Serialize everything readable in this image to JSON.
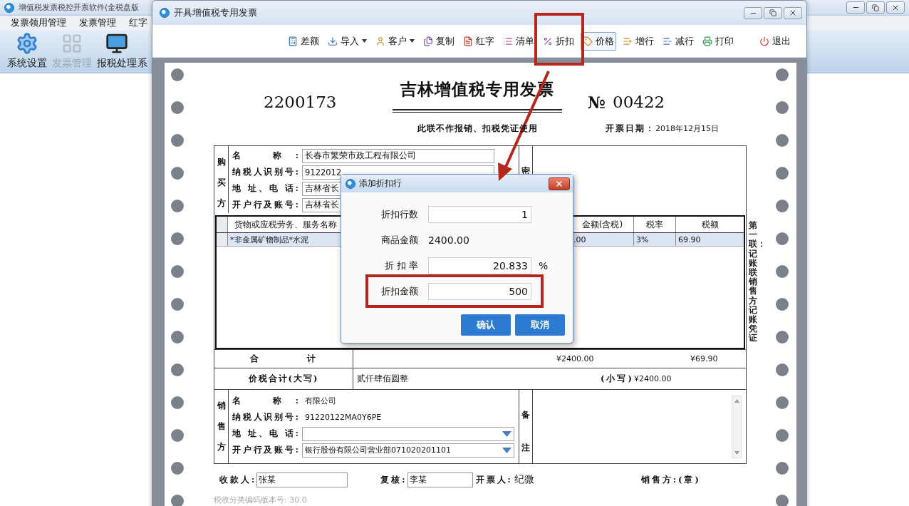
{
  "main_window": {
    "title": "增值税发票税控开票软件(金税盘版",
    "menu": [
      "发票领用管理",
      "发票管理",
      "红字"
    ],
    "toolbar": [
      {
        "label": "系统设置",
        "kind": "gear",
        "disabled": false
      },
      {
        "label": "发票管理",
        "kind": "grid",
        "disabled": true
      },
      {
        "label": "报税处理",
        "kind": "monitor",
        "disabled": false
      },
      {
        "label": "系",
        "kind": "none",
        "disabled": false
      }
    ]
  },
  "invoice_window": {
    "title": "开具增值税专用发票",
    "toolbar": [
      {
        "label": "差额",
        "kind": "calculator",
        "dropdown": false,
        "selected": false,
        "highlighted": false
      },
      {
        "label": "导入",
        "kind": "import",
        "dropdown": true,
        "selected": false,
        "highlighted": false
      },
      {
        "label": "客户",
        "kind": "customer",
        "dropdown": true,
        "selected": false,
        "highlighted": false
      },
      {
        "label": "复制",
        "kind": "copy",
        "dropdown": false,
        "selected": false,
        "highlighted": false
      },
      {
        "label": "红字",
        "kind": "red",
        "dropdown": false,
        "selected": false,
        "highlighted": false
      },
      {
        "label": "清单",
        "kind": "list",
        "dropdown": false,
        "selected": false,
        "highlighted": false
      },
      {
        "label": "折扣",
        "kind": "discount",
        "dropdown": false,
        "selected": false,
        "highlighted": true
      },
      {
        "label": "价格",
        "kind": "price",
        "dropdown": false,
        "selected": true,
        "highlighted": false
      },
      {
        "label": "增行",
        "kind": "add_row",
        "dropdown": false,
        "selected": false,
        "highlighted": false
      },
      {
        "label": "减行",
        "kind": "remove_row",
        "dropdown": false,
        "selected": false,
        "highlighted": false
      },
      {
        "label": "打印",
        "kind": "print",
        "dropdown": false,
        "selected": false,
        "highlighted": false
      },
      {
        "label": "退出",
        "kind": "exit",
        "dropdown": false,
        "selected": false,
        "highlighted": false
      }
    ]
  },
  "invoice": {
    "code": "2200173",
    "title": "吉林增值税专用发票",
    "number_sign": "№",
    "number": "00422",
    "note": "此联不作报销、扣税凭证使用",
    "date_label": "开票日期：",
    "date": "2018年12月15日",
    "buyer": {
      "side_label": "购买方",
      "cipher_label": "密",
      "fields": [
        {
          "label": "名 称:",
          "value": "长春市繁荣市政工程有限公司"
        },
        {
          "label": "纳税人识别号:",
          "value": "9122012"
        },
        {
          "label": "地 址、电 话:",
          "value": "吉林省长"
        },
        {
          "label": "开户行及账号:",
          "value": "吉林省长"
        }
      ]
    },
    "items": {
      "columns": {
        "name": "货物或应税劳务、服务名称",
        "amount": "金额(含税)",
        "rate": "税率",
        "tax": "税额"
      },
      "rows": [
        {
          "name": "*非金属矿物制品*水泥",
          "amount": ".00",
          "rate": "3%",
          "tax": "69.90",
          "selected": true
        }
      ]
    },
    "total": {
      "label": "合 计",
      "amount": "¥2400.00",
      "tax": "¥69.90"
    },
    "grand_total": {
      "label": "价税合计(大写)",
      "words": "贰仟肆佰圆整",
      "figure_label": "(小写)",
      "figure": "¥2400.00"
    },
    "seller": {
      "side_label": "销售方",
      "remarks_label": "备注",
      "fields": [
        {
          "label": "名 称:",
          "kind": "text",
          "value": "有限公司"
        },
        {
          "label": "纳税人识别号:",
          "kind": "text",
          "value": "91220122MA0Y6PE"
        },
        {
          "label": "地 址、电 话:",
          "kind": "select"
        },
        {
          "label": "开户行及账号:",
          "kind": "select",
          "value": "银行股份有限公司营业部071020201101"
        }
      ]
    },
    "signatures": {
      "payee_label": "收款人:",
      "payee": "张某",
      "reviewer_label": "复核:",
      "reviewer": "李某",
      "issuer_label": "开票人:",
      "issuer": "纪微",
      "seal_label": "销售方:(章)"
    },
    "version": "税收分类编码版本号: 30.0",
    "copy_label": "第一联：记账联销售方记账凭证"
  },
  "dialog": {
    "title": "添加折扣行",
    "rows": [
      {
        "label": "折扣行数",
        "kind": "input",
        "value": "1",
        "highlighted": false
      },
      {
        "label": "商品金额",
        "kind": "text",
        "value": "2400.00",
        "highlighted": false
      },
      {
        "label": "折 扣 率",
        "kind": "input",
        "value": "20.833",
        "unit": "%",
        "highlighted": false
      },
      {
        "label": "折扣金额",
        "kind": "input",
        "value": "500",
        "highlighted": true
      }
    ],
    "buttons": [
      "确认",
      "取消"
    ]
  }
}
